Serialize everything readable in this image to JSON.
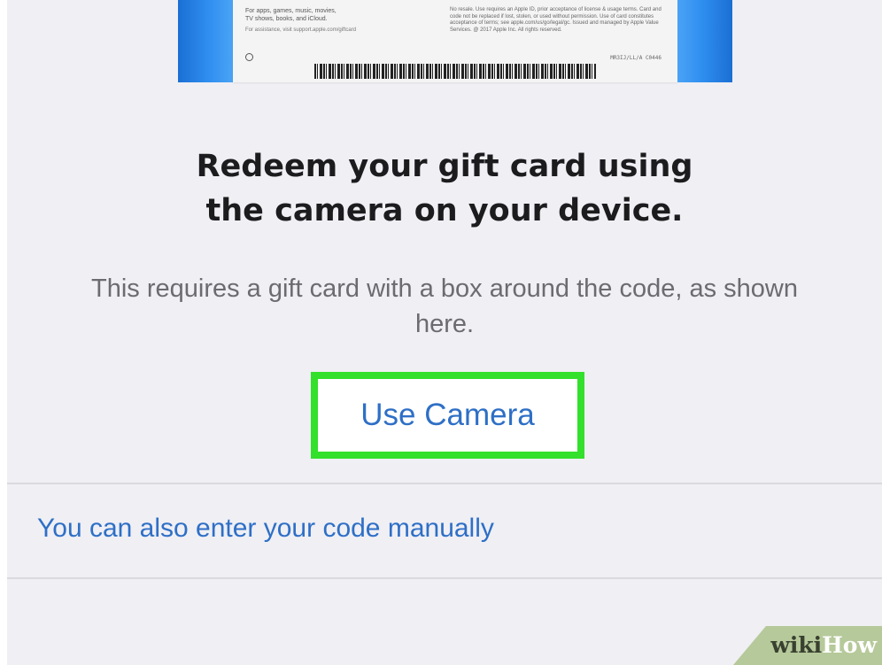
{
  "gift_card": {
    "left_lines": [
      "For apps, games, music, movies,",
      "TV shows, books, and iCloud."
    ],
    "assistance": "For assistance, visit support.apple.com/giftcard",
    "right_text": "No resale. Use requires an Apple ID, prior acceptance of license & usage terms. Card and code not be replaced if lost, stolen, or used without permission. Use of card constitutes acceptance of terms; see apple.com/us/go/legal/gc. Issued and managed by Apple Value Services. @ 2017 Apple Inc. All rights reserved.",
    "serial": "MR3IJ/LL/A C0446"
  },
  "headline": {
    "line1": "Redeem your gift card using",
    "line2": "the camera on your device."
  },
  "subtext": "This requires a gift card with a box around the code, as shown here.",
  "use_camera_button": "Use Camera",
  "manual_entry_link": "You can also enter your code manually",
  "watermark": {
    "wiki": "wiki",
    "how": "How"
  },
  "colors": {
    "background": "#efeff4",
    "link_blue": "#2e6fc6",
    "highlight_green": "#33e02b",
    "card_blue": "#2f8ef0"
  }
}
